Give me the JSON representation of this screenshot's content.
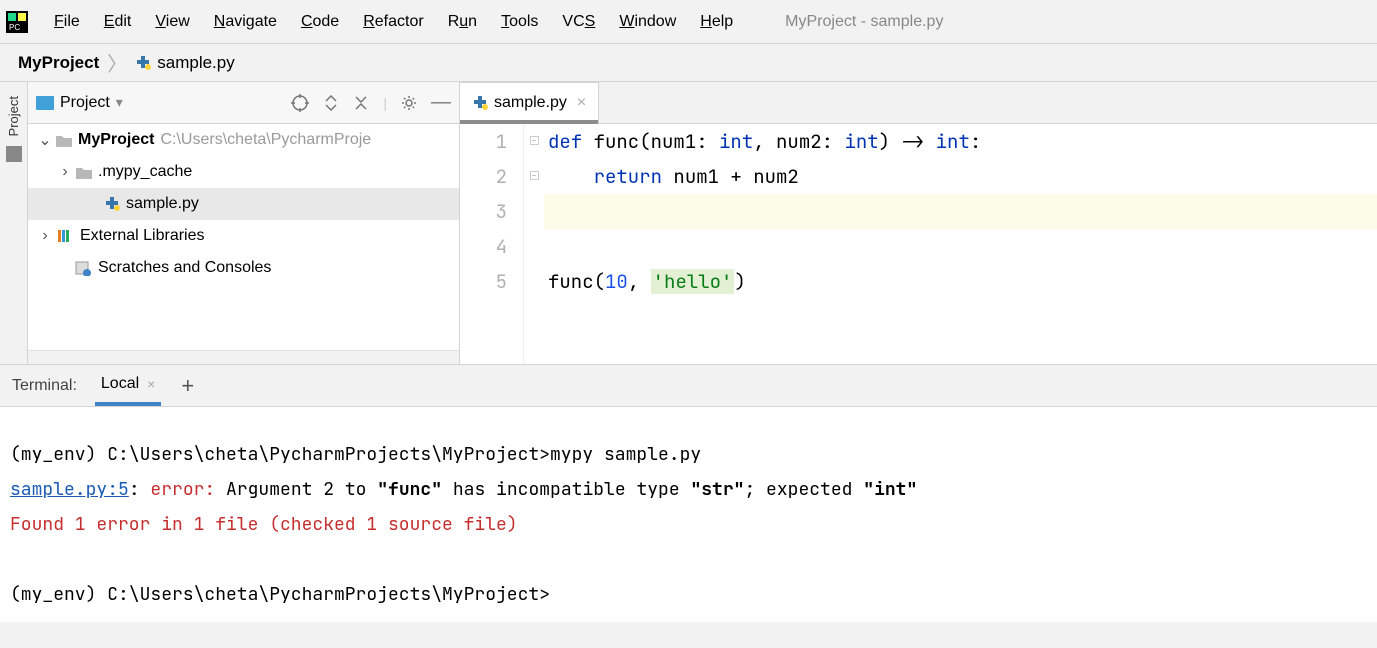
{
  "window_title": "MyProject - sample.py",
  "menu": [
    "File",
    "Edit",
    "View",
    "Navigate",
    "Code",
    "Refactor",
    "Run",
    "Tools",
    "VCS",
    "Window",
    "Help"
  ],
  "breadcrumb": {
    "project": "MyProject",
    "file": "sample.py"
  },
  "rail": {
    "project_label": "Project"
  },
  "project_panel": {
    "title": "Project",
    "root_name": "MyProject",
    "root_path": "C:\\Users\\cheta\\PycharmProje",
    "mypy_cache": ".mypy_cache",
    "sample_file": "sample.py",
    "external_libs": "External Libraries",
    "scratches": "Scratches and Consoles"
  },
  "editor": {
    "tab_name": "sample.py",
    "line_numbers": [
      "1",
      "2",
      "3",
      "4",
      "5"
    ],
    "code": {
      "l1_def": "def ",
      "l1_func": "func",
      "l1_p": "(num1: ",
      "l1_int1": "int",
      "l1_c": ", num2: ",
      "l1_int2": "int",
      "l1_arr": ") -> ",
      "l1_int3": "int",
      "l1_colon": ":",
      "l2_ret": "return ",
      "l2_expr": "num1 + num2",
      "l5_call": "func(",
      "l5_num": "10",
      "l5_comma": ", ",
      "l5_str": "'hello'",
      "l5_close": ")"
    }
  },
  "terminal": {
    "label": "Terminal:",
    "tab": "Local",
    "prompt1": "(my_env) C:\\Users\\cheta\\PycharmProjects\\MyProject>mypy sample.py",
    "err_loc": "sample.py:5",
    "err_sep": ": ",
    "err_kw": "error:",
    "err_msg_a": " Argument 2 to ",
    "err_func": "\"func\"",
    "err_msg_b": " has incompatible type ",
    "err_type_got": "\"str\"",
    "err_msg_c": "; expected ",
    "err_type_exp": "\"int\"",
    "summary": "Found 1 error in 1 file (checked 1 source file)",
    "prompt2": "(my_env) C:\\Users\\cheta\\PycharmProjects\\MyProject>"
  }
}
